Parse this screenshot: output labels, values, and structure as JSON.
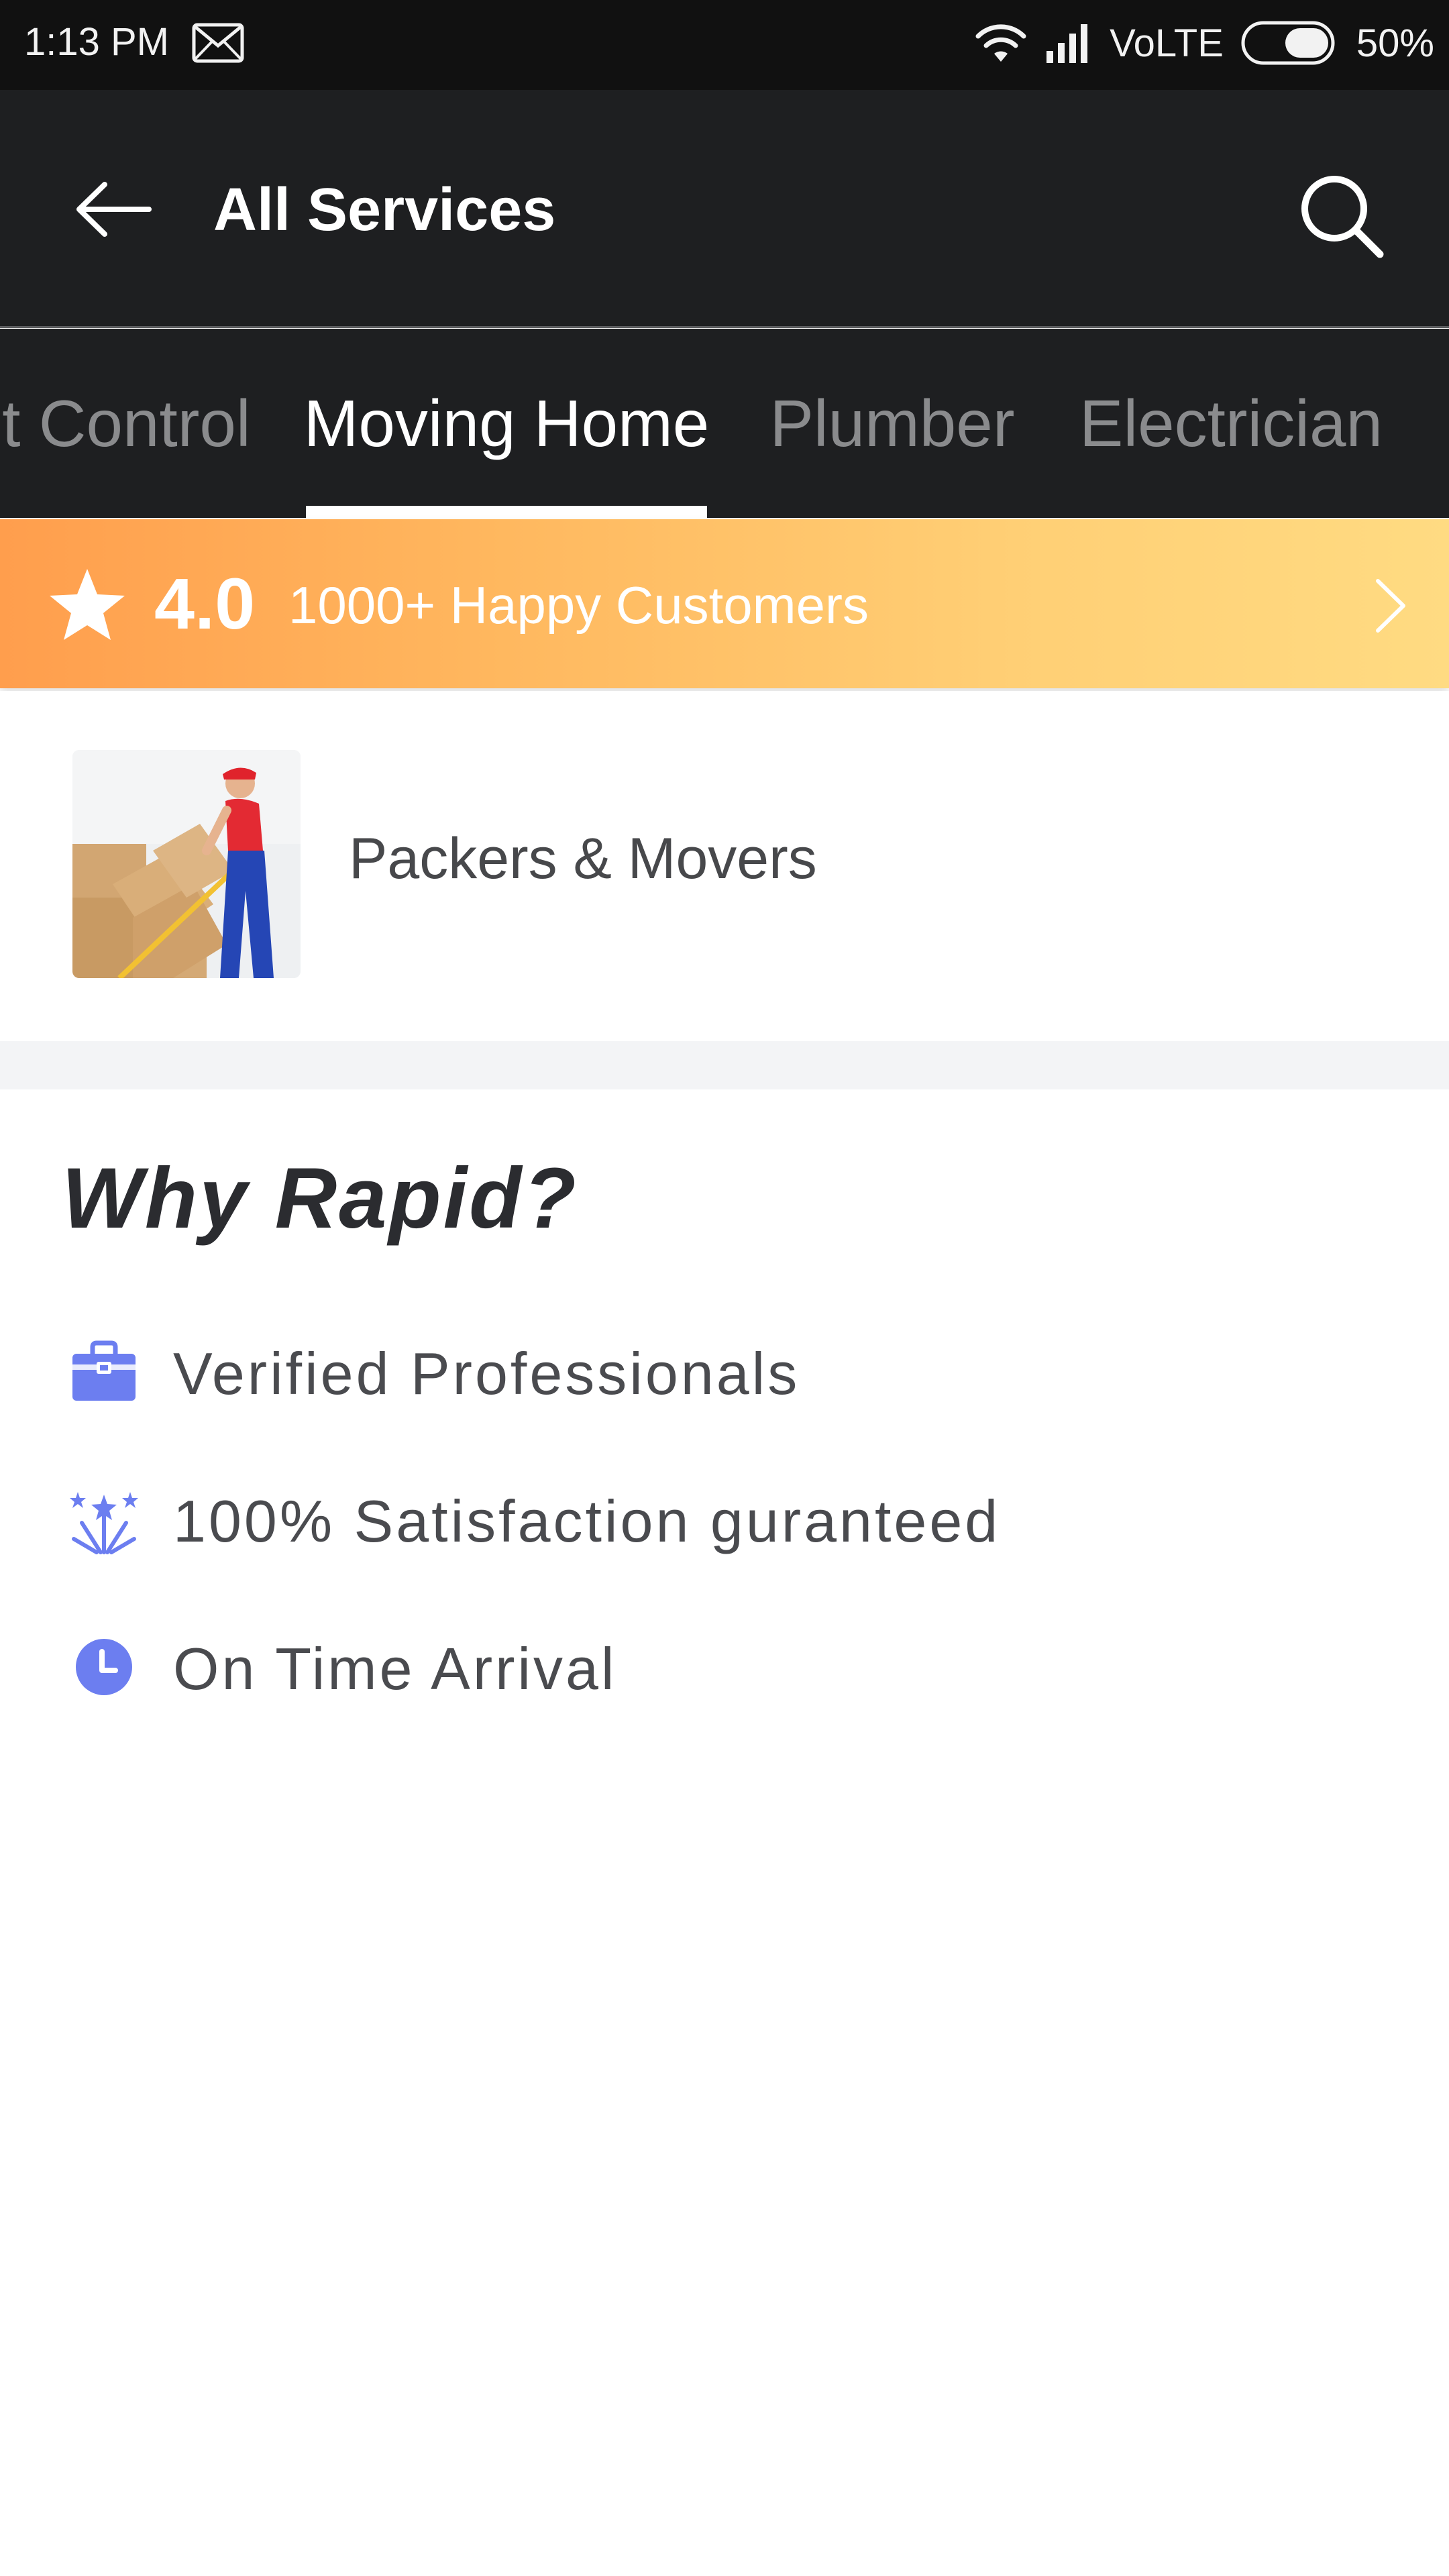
{
  "status_bar": {
    "time": "1:13 PM",
    "network": "VoLTE",
    "battery": "50%"
  },
  "app_bar": {
    "title": "All Services"
  },
  "tabs": [
    {
      "label": "Pest Control"
    },
    {
      "label": "Moving Home",
      "selected": true
    },
    {
      "label": "Plumber"
    },
    {
      "label": "Electrician"
    }
  ],
  "rating_banner": {
    "rating": "4.0",
    "text": "1000+ Happy Customers"
  },
  "services": [
    {
      "name": "Packers & Movers"
    }
  ],
  "why_section": {
    "title": "Why Rapid?",
    "features": [
      {
        "text": "Verified Professionals",
        "icon": "briefcase-icon"
      },
      {
        "text": "100% Satisfaction guranteed",
        "icon": "sparkle-burst-icon"
      },
      {
        "text": "On Time Arrival",
        "icon": "clock-icon"
      }
    ]
  },
  "colors": {
    "appbar_bg": "#1e1f21",
    "accent_icon": "#6c7ef0",
    "banner_start": "#ff9e4d",
    "banner_end": "#ffdb82"
  }
}
